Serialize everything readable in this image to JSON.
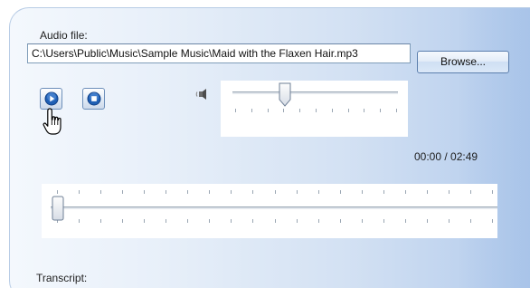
{
  "audio": {
    "label": "Audio file:",
    "path": "C:\\Users\\Public\\Music\\Sample Music\\Maid with the Flaxen Hair.mp3",
    "browse_label": "Browse..."
  },
  "player": {
    "time": "00:00 / 02:49",
    "volume_level": 0.35,
    "position_level": 0.0
  },
  "transcript": {
    "label": "Transcript:"
  },
  "icons": {
    "play": "play-icon",
    "stop": "stop-icon",
    "speaker": "speaker-icon",
    "cursor": "hand-cursor-icon"
  },
  "colors": {
    "accent": "#2b6fc2",
    "panel": "#d3e1f3"
  }
}
